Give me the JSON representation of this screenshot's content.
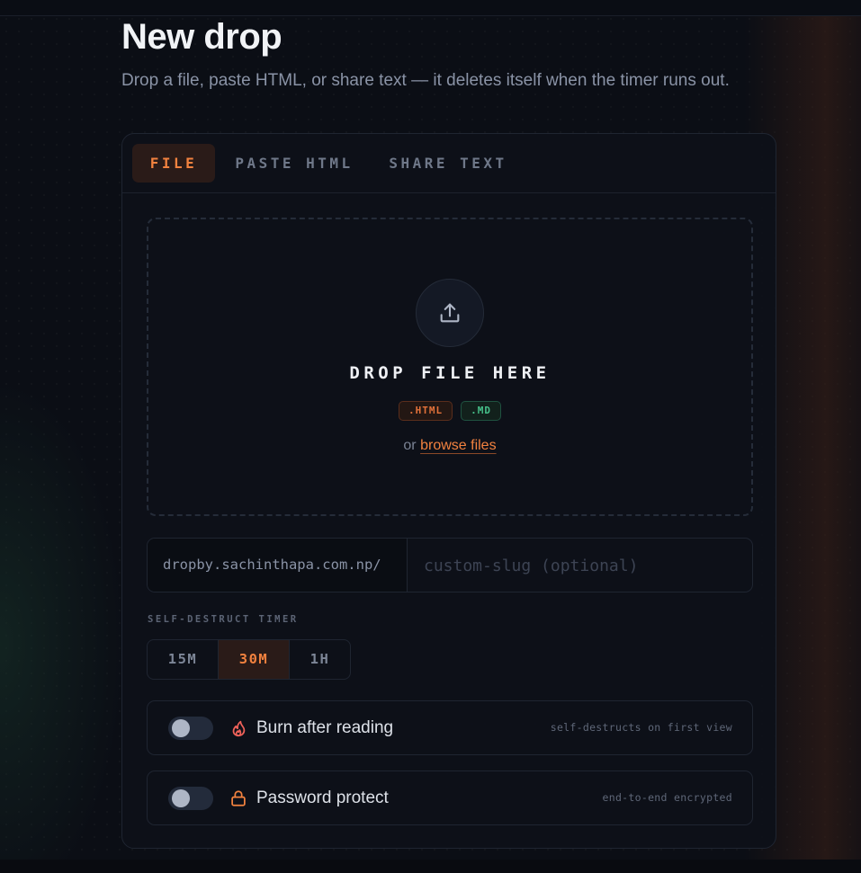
{
  "page": {
    "title": "New drop",
    "subtitle": "Drop a file, paste HTML, or share text — it deletes itself when the timer runs out."
  },
  "tabs": [
    {
      "label": "FILE",
      "active": true
    },
    {
      "label": "PASTE HTML",
      "active": false
    },
    {
      "label": "SHARE TEXT",
      "active": false
    }
  ],
  "dropzone": {
    "icon": "upload-icon",
    "heading": "DROP FILE HERE",
    "badges": [
      ".HTML",
      ".MD"
    ],
    "browse_prefix": "or",
    "browse_link": "browse files"
  },
  "slug": {
    "prefix": "dropby.sachinthapa.com.np/",
    "value": "",
    "placeholder": "custom-slug (optional)"
  },
  "timer": {
    "label": "SELF-DESTRUCT TIMER",
    "options": [
      "15M",
      "30M",
      "1H"
    ],
    "selected": "30M"
  },
  "options": {
    "burn": {
      "label": "Burn after reading",
      "hint": "self-destructs on first view",
      "icon": "flame-icon",
      "enabled": false
    },
    "password": {
      "label": "Password protect",
      "hint": "end-to-end encrypted",
      "icon": "lock-icon",
      "enabled": false
    }
  },
  "colors": {
    "accent": "#f2823f",
    "accent_bg": "#2a1b18",
    "md_badge": "#46c08a",
    "background": "#0b0e15",
    "card": "#0e1119"
  }
}
